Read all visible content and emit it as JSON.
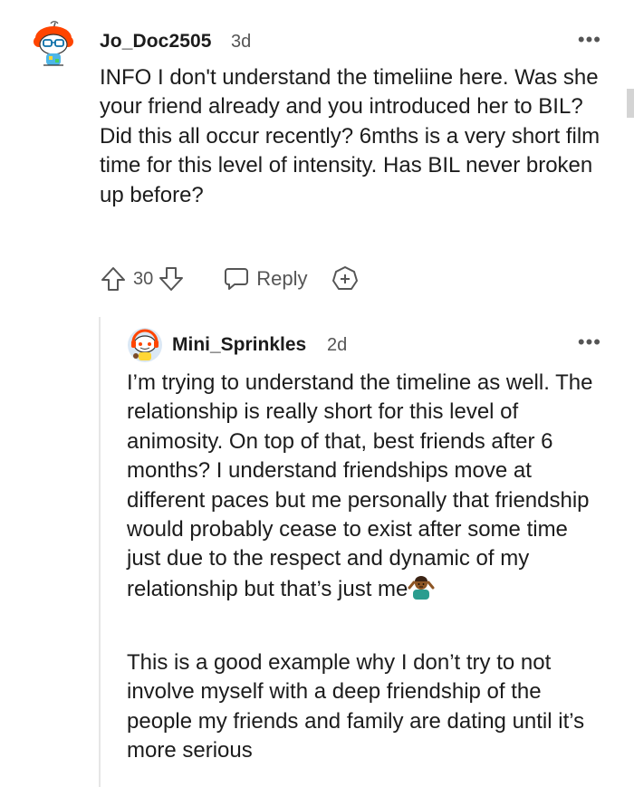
{
  "comment": {
    "username": "Jo_Doc2505",
    "time": "3d",
    "avatar_icon": "snoo-avatar-glasses-icon",
    "body": "INFO I don't understand the timeliine here. Was she your friend already and you introduced her to BIL? Did this all occur recently? 6mths is a very short film time for this level of intensity. Has BIL never broken up before?",
    "votes": "30",
    "reply_label": "Reply",
    "more_label": "•••",
    "icons": {
      "upvote": "upvote-arrow-icon",
      "downvote": "downvote-arrow-icon",
      "reply": "speech-bubble-icon",
      "award": "add-award-icon"
    }
  },
  "reply": {
    "username": "Mini_Sprinkles",
    "time": "2d",
    "avatar_icon": "snoo-avatar-headset-icon",
    "more_label": "•••",
    "paragraph1": "I’m trying to understand the timeline as well. The relationship is really short for this level of animosity. On top of that, best friends after 6 months? I understand friendships move at different paces but me personally that friendship would probably cease to exist after some time just due to the respect and dynamic of my relationship but that’s just me",
    "paragraph1_emoji": "person-shrugging-emoji",
    "paragraph2": "This is a good example why I don’t try to not involve myself with a deep friendship of the people my friends and family are dating until it’s more serious"
  },
  "colors": {
    "text": "#1c1c1c",
    "meta": "#555555",
    "thread_line": "#e6e6e6",
    "avatar_accent": "#ff4500"
  }
}
